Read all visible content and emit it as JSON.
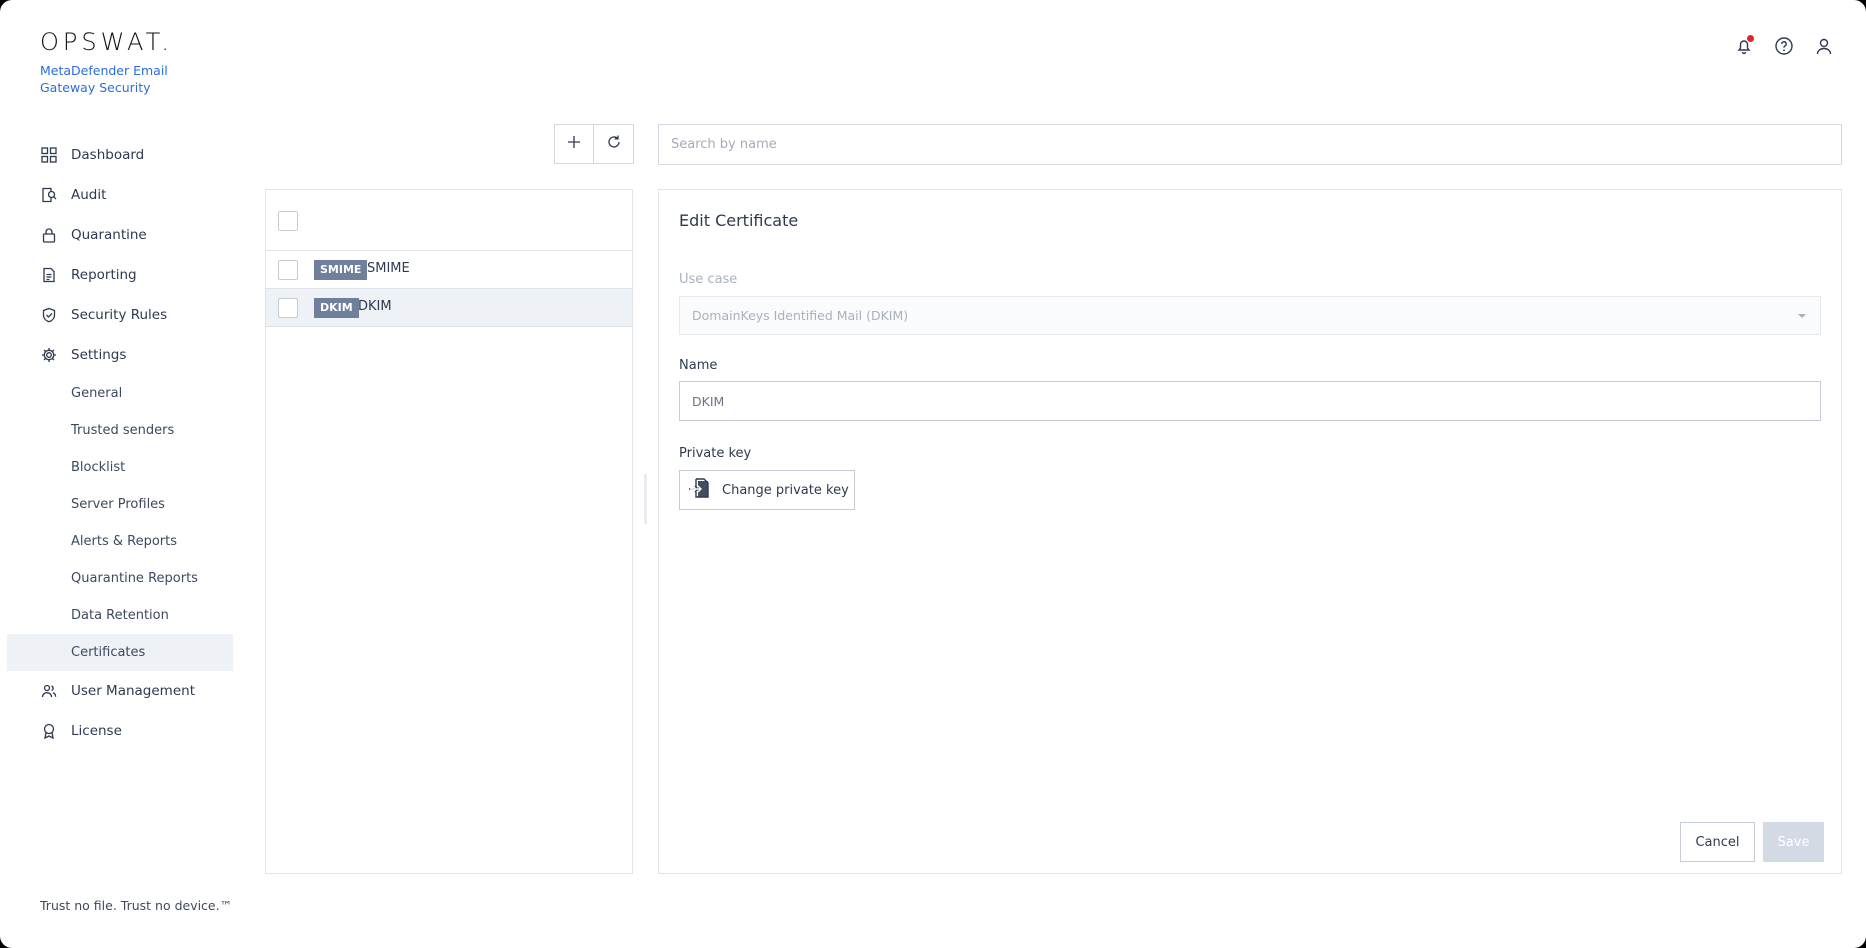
{
  "brand": {
    "logo_text": "OPSWAT.",
    "product_name": "MetaDefender Email Gateway Security",
    "tagline": "Trust no file. Trust no device.™",
    "accent_color": "#2b6de0"
  },
  "header": {
    "icons": [
      "bell-icon",
      "help-icon",
      "user-icon"
    ],
    "notification_dot_color": "#e3262b"
  },
  "sidebar": {
    "items": [
      {
        "label": "Dashboard",
        "icon": "dashboard-icon"
      },
      {
        "label": "Audit",
        "icon": "audit-icon"
      },
      {
        "label": "Quarantine",
        "icon": "lock-icon"
      },
      {
        "label": "Reporting",
        "icon": "document-icon"
      },
      {
        "label": "Security Rules",
        "icon": "shield-check-icon"
      },
      {
        "label": "Settings",
        "icon": "gear-icon"
      }
    ],
    "settings_sub": [
      {
        "label": "General"
      },
      {
        "label": "Trusted senders"
      },
      {
        "label": "Blocklist"
      },
      {
        "label": "Server Profiles"
      },
      {
        "label": "Alerts & Reports"
      },
      {
        "label": "Quarantine Reports"
      },
      {
        "label": "Data Retention"
      },
      {
        "label": "Certificates",
        "active": true
      }
    ],
    "bottom_items": [
      {
        "label": "User Management",
        "icon": "users-icon"
      },
      {
        "label": "License",
        "icon": "award-icon"
      }
    ]
  },
  "toolbar": {
    "add_icon": "plus-icon",
    "refresh_icon": "refresh-icon",
    "search_placeholder": "Search by name"
  },
  "certificate_list": {
    "rows": [
      {
        "badge": "SMIME",
        "name": "SMIME",
        "selected": false
      },
      {
        "badge": "DKIM",
        "name": "DKIM",
        "selected": true
      }
    ]
  },
  "edit": {
    "title": "Edit Certificate",
    "use_case_label": "Use case",
    "use_case_value": "DomainKeys Identified Mail (DKIM)",
    "name_label": "Name",
    "name_value": "DKIM",
    "private_key_label": "Private key",
    "change_key_button": "Change private key",
    "cancel_button": "Cancel",
    "save_button": "Save"
  }
}
